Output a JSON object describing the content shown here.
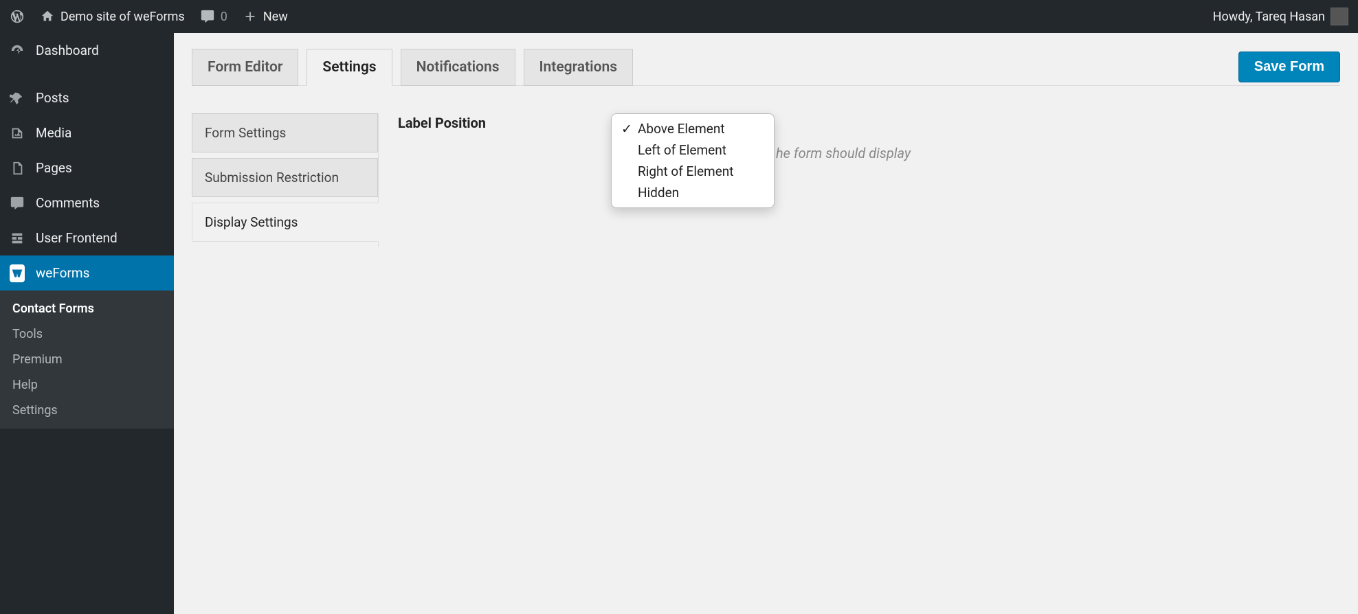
{
  "adminbar": {
    "site_title": "Demo site of weForms",
    "comment_count": "0",
    "new_label": "New",
    "howdy": "Howdy, Tareq Hasan"
  },
  "sidebar": {
    "items": [
      {
        "label": "Dashboard"
      },
      {
        "label": "Posts"
      },
      {
        "label": "Media"
      },
      {
        "label": "Pages"
      },
      {
        "label": "Comments"
      },
      {
        "label": "User Frontend"
      },
      {
        "label": "weForms"
      }
    ],
    "submenu": [
      {
        "label": "Contact Forms"
      },
      {
        "label": "Tools"
      },
      {
        "label": "Premium"
      },
      {
        "label": "Help"
      },
      {
        "label": "Settings"
      }
    ]
  },
  "tabs": [
    {
      "label": "Form Editor"
    },
    {
      "label": "Settings"
    },
    {
      "label": "Notifications"
    },
    {
      "label": "Integrations"
    }
  ],
  "save_button": "Save Form",
  "settings_nav": [
    {
      "label": "Form Settings"
    },
    {
      "label": "Submission Restriction"
    },
    {
      "label": "Display Settings"
    }
  ],
  "field": {
    "label": "Label Position",
    "hint_suffix": "he form should display",
    "options": [
      "Above Element",
      "Left of Element",
      "Right of Element",
      "Hidden"
    ],
    "selected_index": 0
  }
}
